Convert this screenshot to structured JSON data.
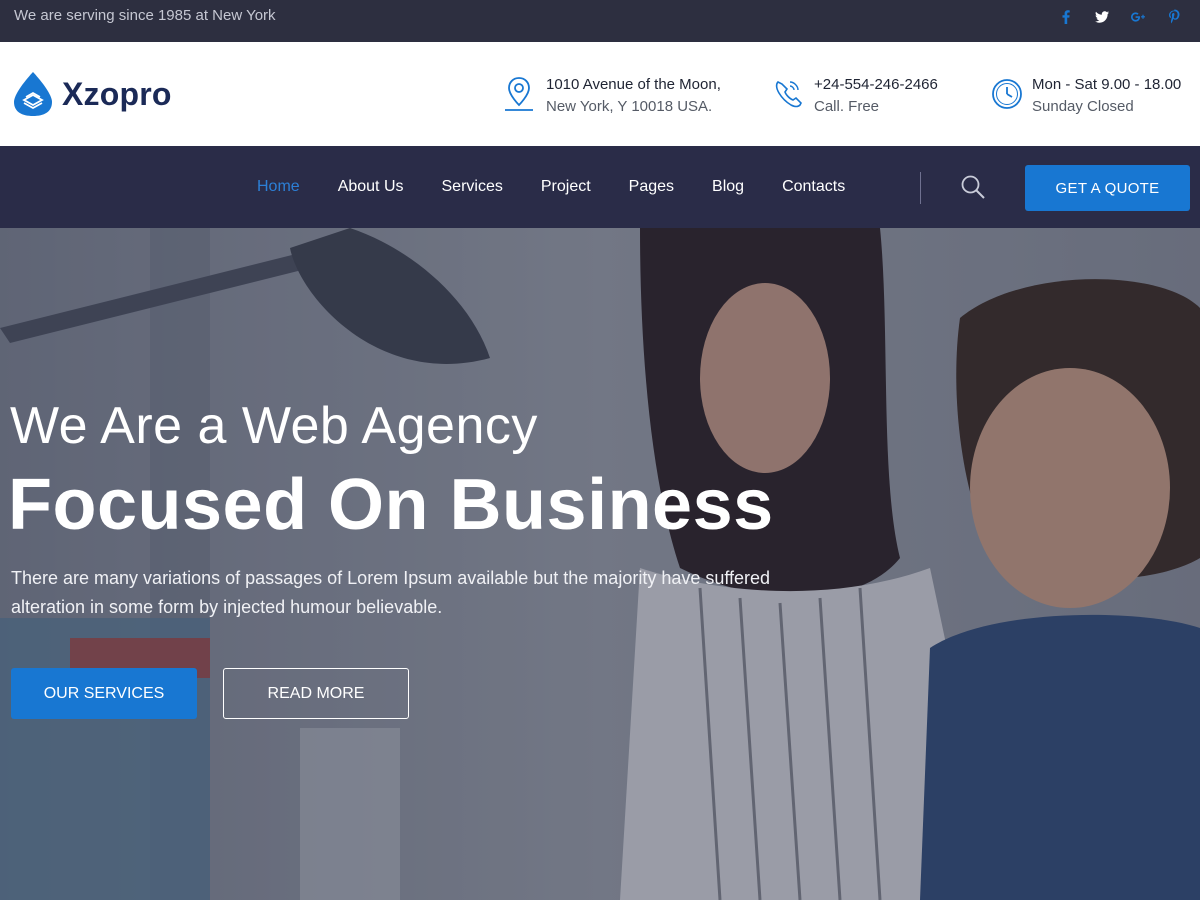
{
  "topbar": {
    "tagline": "We are serving since 1985 at New York",
    "social": [
      {
        "icon": "facebook-icon"
      },
      {
        "icon": "twitter-icon"
      },
      {
        "icon": "google-plus-icon"
      },
      {
        "icon": "pinterest-icon"
      }
    ]
  },
  "header": {
    "logo_text": "Xzopro",
    "address": {
      "line1": "1010 Avenue of the Moon,",
      "line2": "New York, Y 10018 USA."
    },
    "phone": {
      "line1": "+24-554-246-2466",
      "line2": "Call. Free"
    },
    "hours": {
      "line1": "Mon - Sat 9.00 - 18.00",
      "line2": "Sunday Closed"
    }
  },
  "nav": {
    "items": [
      {
        "label": "Home",
        "active": true
      },
      {
        "label": "About Us"
      },
      {
        "label": "Services"
      },
      {
        "label": "Project"
      },
      {
        "label": "Pages"
      },
      {
        "label": "Blog"
      },
      {
        "label": "Contacts"
      }
    ],
    "quote_label": "GET A QUOTE"
  },
  "hero": {
    "subtitle": "We Are a Web Agency",
    "title": "Focused On Business",
    "text": "There are many variations of passages of Lorem Ipsum available but the majority have suffered alteration in some form by injected humour believable.",
    "primary_label": "OUR SERVICES",
    "secondary_label": "READ MORE"
  },
  "colors": {
    "accent": "#1877d2",
    "topbar_bg": "#2d2f40",
    "nav_bg": "#2a2c48",
    "active_link": "#2c7fd6"
  }
}
